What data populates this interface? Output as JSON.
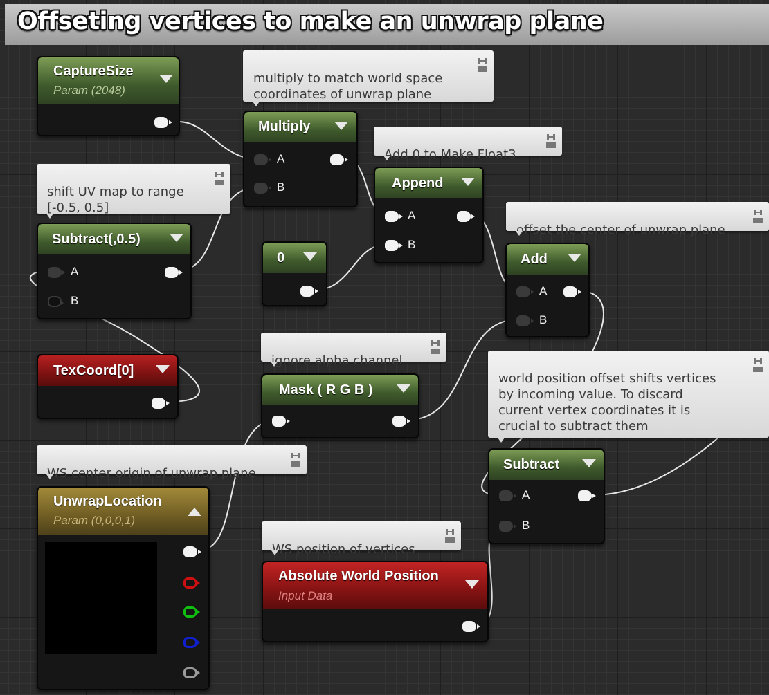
{
  "title": "Offseting vertices to make an unwrap plane",
  "comments": {
    "multiply": "multiply to match world space\ncoordinates of unwrap plane",
    "append": "Add 0 to Make Float3",
    "shift_uv": "shift UV map to range\n[-0.5, 0.5]",
    "offset_center": "offset the center of unwrap plane",
    "ignore_alpha": "ignore alpha channel",
    "wpo": "world position offset shifts vertices\nby incoming value. To discard\ncurrent vertex coordinates it is\ncrucial to subtract them",
    "ws_center": "WS center origin of unwrap plane",
    "ws_position": "WS position of vertices"
  },
  "nodes": {
    "capture_size": {
      "title": "CaptureSize",
      "subtitle": "Param (2048)"
    },
    "multiply": {
      "title": "Multiply",
      "pin_a": "A",
      "pin_b": "B"
    },
    "append": {
      "title": "Append",
      "pin_a": "A",
      "pin_b": "B"
    },
    "subtract_half": {
      "title": "Subtract(,0.5)",
      "pin_a": "A",
      "pin_b": "B"
    },
    "constant": {
      "title": "0"
    },
    "add": {
      "title": "Add",
      "pin_a": "A",
      "pin_b": "B"
    },
    "texcoord": {
      "title": "TexCoord[0]"
    },
    "mask": {
      "title": "Mask ( R G B )"
    },
    "unwrap_location": {
      "title": "UnwrapLocation",
      "subtitle": "Param (0,0,0,1)"
    },
    "subtract": {
      "title": "Subtract",
      "pin_a": "A",
      "pin_b": "B"
    },
    "abs_world_pos": {
      "title": "Absolute World Position",
      "subtitle": "Input Data"
    }
  },
  "colors": {
    "pin_red": "#d01010",
    "pin_green": "#10c010",
    "pin_blue": "#1020d0",
    "pin_alpha": "#9a9a9a"
  }
}
